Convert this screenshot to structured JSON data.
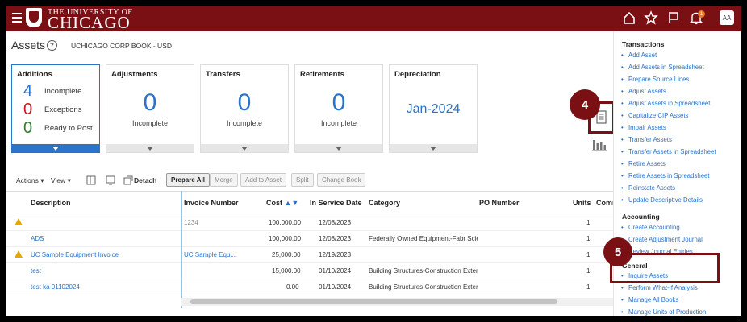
{
  "header": {
    "logo_line1": "THE UNIVERSITY OF",
    "logo_line2": "CHICAGO",
    "notification_count": "1",
    "avatar_initials": "AA"
  },
  "page": {
    "title": "Assets",
    "book": "UCHICAGO CORP BOOK - USD"
  },
  "tiles": {
    "additions": {
      "title": "Additions",
      "rows": [
        {
          "count": "4",
          "label": "Incomplete"
        },
        {
          "count": "0",
          "label": "Exceptions"
        },
        {
          "count": "0",
          "label": "Ready to Post"
        }
      ]
    },
    "adjustments": {
      "title": "Adjustments",
      "value": "0",
      "label": "Incomplete"
    },
    "transfers": {
      "title": "Transfers",
      "value": "0",
      "label": "Incomplete"
    },
    "retirements": {
      "title": "Retirements",
      "value": "0",
      "label": "Incomplete"
    },
    "depreciation": {
      "title": "Depreciation",
      "value": "Jan-2024"
    }
  },
  "callouts": {
    "step4": "4",
    "step5": "5"
  },
  "toolbar": {
    "actions": "Actions",
    "view": "View",
    "detach": "Detach",
    "prepare_all": "Prepare All",
    "merge": "Merge",
    "add_to_asset": "Add to Asset",
    "split": "Split",
    "change_book": "Change Book"
  },
  "table": {
    "headers": {
      "description": "Description",
      "invoice": "Invoice Number",
      "cost": "Cost",
      "in_service": "In Service Date",
      "category": "Category",
      "po": "PO Number",
      "units": "Units",
      "comm": "Comm"
    },
    "rows": [
      {
        "description": "",
        "invoice": "1234",
        "cost": "100,000.00",
        "date": "12/08/2023",
        "category": "",
        "units": "1"
      },
      {
        "description": "ADS",
        "invoice": "",
        "cost": "100,000.00",
        "date": "12/08/2023",
        "category": "Federally Owned Equipment-Fabr Scie",
        "units": "1"
      },
      {
        "description": "UC Sample Equipment Invoice",
        "invoice": "UC Sample Equ...",
        "cost": "25,000.00",
        "date": "12/19/2023",
        "category": "",
        "units": "1"
      },
      {
        "description": "test",
        "invoice": "",
        "cost": "15,000.00",
        "date": "01/10/2024",
        "category": "Building Structures-Construction Exteri",
        "units": "1"
      },
      {
        "description": "test ka 01102024",
        "invoice": "",
        "cost": "0.00",
        "date": "01/10/2024",
        "category": "Building Structures-Construction Exteri",
        "units": "1"
      }
    ]
  },
  "panel": {
    "transactions_title": "Transactions",
    "transactions": [
      "Add Asset",
      "Add Assets in Spreadsheet",
      "Prepare Source Lines",
      "Adjust Assets",
      "Adjust Assets in Spreadsheet",
      "Capitalize CIP Assets",
      "Impair Assets",
      "Transfer Assets",
      "Transfer Assets in Spreadsheet",
      "Retire Assets",
      "Retire Assets in Spreadsheet",
      "Reinstate Assets",
      "Update Descriptive Details"
    ],
    "accounting_title": "Accounting",
    "accounting": [
      "Create Accounting",
      "Create Adjustment Journal",
      "Review Journal Entries"
    ],
    "general_title": "General",
    "general": [
      "Inquire Assets",
      "Perform What-If Analysis",
      "Manage All Books",
      "Manage Units of Production"
    ]
  }
}
